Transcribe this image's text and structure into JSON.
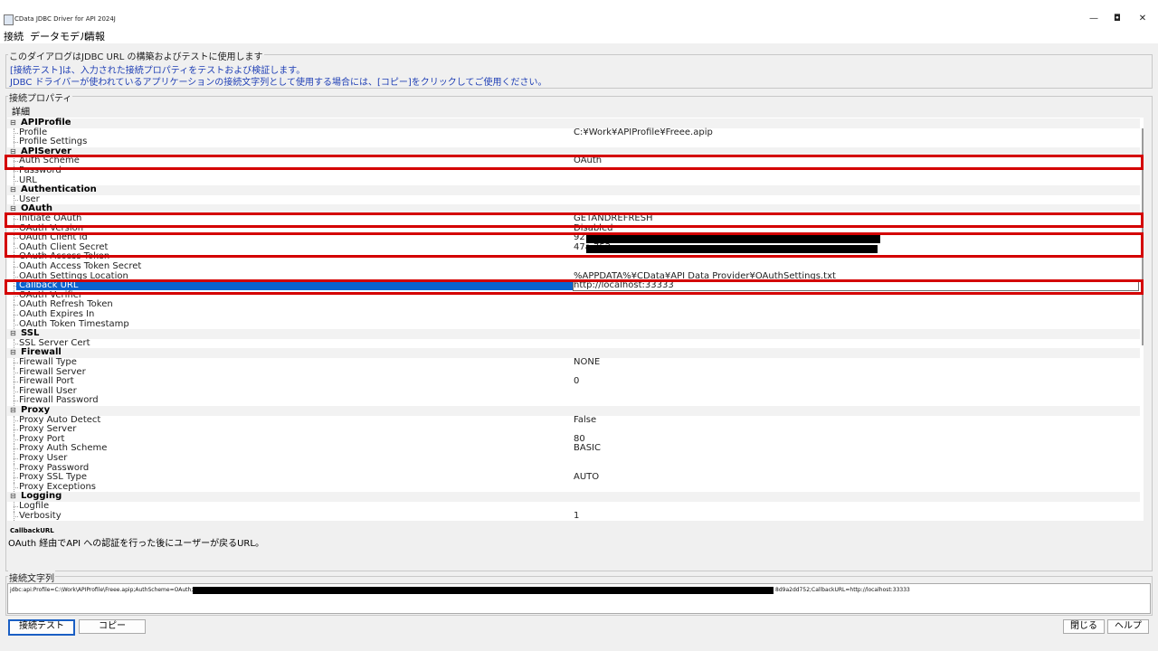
{
  "window": {
    "title": "CData JDBC Driver for API 2024J",
    "controls": {
      "minimize": "—",
      "maximize": "◘",
      "close": "✕"
    }
  },
  "menu": [
    "接続",
    "データモデル",
    "情報"
  ],
  "intro": {
    "legend": "このダイアログはJDBC URL の構築およびテストに使用します",
    "line1": "[接続テスト]は、入力された接続プロパティをテストおよび検証します。",
    "line2": "JDBC ドライバーが使われているアプリケーションの接続文字列として使用する場合には、[コピー]をクリックしてご使用ください。"
  },
  "properties": {
    "legend": "接続プロパティ",
    "detail_label": "詳細",
    "rows": [
      {
        "kind": "cat",
        "label": "APIProfile",
        "toggle": "⊟"
      },
      {
        "kind": "prop",
        "name": "Profile",
        "value": "C:¥Work¥APIProfile¥Freee.apip"
      },
      {
        "kind": "prop",
        "name": "Profile Settings",
        "value": ""
      },
      {
        "kind": "cat",
        "label": "APIServer",
        "toggle": "⊟"
      },
      {
        "kind": "prop",
        "name": "Auth Scheme",
        "value": "OAuth"
      },
      {
        "kind": "prop",
        "name": "Password",
        "value": ""
      },
      {
        "kind": "prop",
        "name": "URL",
        "value": ""
      },
      {
        "kind": "cat",
        "label": "Authentication",
        "toggle": "⊟"
      },
      {
        "kind": "prop",
        "name": "User",
        "value": ""
      },
      {
        "kind": "cat",
        "label": "OAuth",
        "toggle": "⊟"
      },
      {
        "kind": "prop",
        "name": "Initiate OAuth",
        "value": "GETANDREFRESH"
      },
      {
        "kind": "prop",
        "name": "OAuth Version",
        "value": "Disabled"
      },
      {
        "kind": "prop",
        "name": "OAuth Client Id",
        "value": "92                                                                      4019"
      },
      {
        "kind": "prop",
        "name": "OAuth Client Secret",
        "value": "47a                                                                     752"
      },
      {
        "kind": "prop",
        "name": "OAuth Access Token",
        "value": ""
      },
      {
        "kind": "prop",
        "name": "OAuth Access Token Secret",
        "value": ""
      },
      {
        "kind": "prop",
        "name": "OAuth Settings Location",
        "value": "%APPDATA%¥CData¥API Data Provider¥OAuthSettings.txt"
      },
      {
        "kind": "prop",
        "name": "Callback URL",
        "value": "http://localhost:33333",
        "selected": true
      },
      {
        "kind": "prop",
        "name": "OAuth Verifier",
        "value": ""
      },
      {
        "kind": "prop",
        "name": "OAuth Refresh Token",
        "value": ""
      },
      {
        "kind": "prop",
        "name": "OAuth Expires In",
        "value": ""
      },
      {
        "kind": "prop",
        "name": "OAuth Token Timestamp",
        "value": ""
      },
      {
        "kind": "cat",
        "label": "SSL",
        "toggle": "⊟"
      },
      {
        "kind": "prop",
        "name": "SSL Server Cert",
        "value": ""
      },
      {
        "kind": "cat",
        "label": "Firewall",
        "toggle": "⊟"
      },
      {
        "kind": "prop",
        "name": "Firewall Type",
        "value": "NONE"
      },
      {
        "kind": "prop",
        "name": "Firewall Server",
        "value": ""
      },
      {
        "kind": "prop",
        "name": "Firewall Port",
        "value": "0"
      },
      {
        "kind": "prop",
        "name": "Firewall User",
        "value": ""
      },
      {
        "kind": "prop",
        "name": "Firewall Password",
        "value": ""
      },
      {
        "kind": "cat",
        "label": "Proxy",
        "toggle": "⊟"
      },
      {
        "kind": "prop",
        "name": "Proxy Auto Detect",
        "value": "False"
      },
      {
        "kind": "prop",
        "name": "Proxy Server",
        "value": ""
      },
      {
        "kind": "prop",
        "name": "Proxy Port",
        "value": "80"
      },
      {
        "kind": "prop",
        "name": "Proxy Auth Scheme",
        "value": "BASIC"
      },
      {
        "kind": "prop",
        "name": "Proxy User",
        "value": ""
      },
      {
        "kind": "prop",
        "name": "Proxy Password",
        "value": ""
      },
      {
        "kind": "prop",
        "name": "Proxy SSL Type",
        "value": "AUTO"
      },
      {
        "kind": "prop",
        "name": "Proxy Exceptions",
        "value": ""
      },
      {
        "kind": "cat",
        "label": "Logging",
        "toggle": "⊟"
      },
      {
        "kind": "prop",
        "name": "Logfile",
        "value": ""
      },
      {
        "kind": "prop",
        "name": "Verbosity",
        "value": "1"
      }
    ]
  },
  "help": {
    "title": "CallbackURL",
    "text": "OAuth 経由でAPI への認証を行った後にユーザーが戻るURL。"
  },
  "connection_string": {
    "legend": "接続文字列",
    "prefix": "jdbc:api:Profile=C:\\Work\\APIProfile\\Freee.apip;AuthScheme=OAuth;",
    "suffix": "8d9a2dd752;CallbackURL=http://localhost:33333"
  },
  "buttons": {
    "test": "接続テスト",
    "copy": "コピー",
    "close": "閉じる",
    "help": "ヘルプ"
  }
}
